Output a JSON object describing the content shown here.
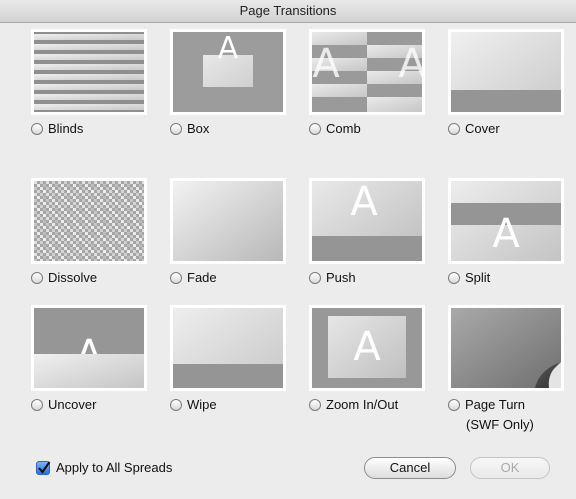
{
  "window": {
    "title": "Page Transitions"
  },
  "transitions": [
    {
      "label": "Blinds",
      "icon": "blinds-preview",
      "selected": false
    },
    {
      "label": "Box",
      "icon": "box-preview",
      "selected": false
    },
    {
      "label": "Comb",
      "icon": "comb-preview",
      "selected": false
    },
    {
      "label": "Cover",
      "icon": "cover-preview",
      "selected": false
    },
    {
      "label": "Dissolve",
      "icon": "dissolve-preview",
      "selected": false
    },
    {
      "label": "Fade",
      "icon": "fade-preview",
      "selected": false
    },
    {
      "label": "Push",
      "icon": "push-preview",
      "selected": false
    },
    {
      "label": "Split",
      "icon": "split-preview",
      "selected": false
    },
    {
      "label": "Uncover",
      "icon": "uncover-preview",
      "selected": false
    },
    {
      "label": "Wipe",
      "icon": "wipe-preview",
      "selected": false
    },
    {
      "label": "Zoom In/Out",
      "icon": "zoom-preview",
      "selected": false
    },
    {
      "label": "Page Turn",
      "sublabel": "(SWF Only)",
      "icon": "page-turn-preview",
      "selected": false
    }
  ],
  "footer": {
    "apply_all_label": "Apply to All Spreads",
    "apply_all_checked": true,
    "cancel_label": "Cancel",
    "ok_label": "OK"
  },
  "colors": {
    "thumb_gray": "#9a9a9a",
    "thumb_light": "#d9d9d9",
    "checkbox_blue": "#2d6fd8"
  }
}
